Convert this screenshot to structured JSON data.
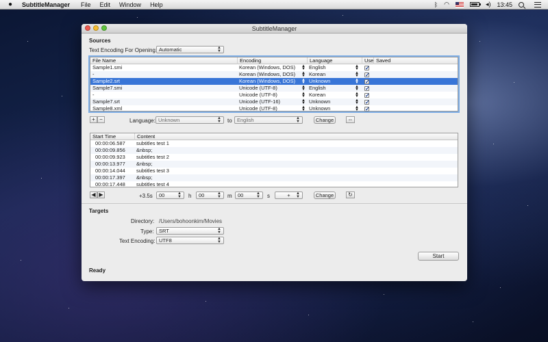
{
  "menubar": {
    "app_name": "SubtitleManager",
    "items": [
      "File",
      "Edit",
      "Window",
      "Help"
    ],
    "clock": "13:45"
  },
  "window": {
    "title": "SubtitleManager"
  },
  "sources": {
    "title": "Sources",
    "encoding_label": "Text Encoding For Opening:",
    "encoding_value": "Automatic",
    "columns": [
      "File Name",
      "Encoding",
      "Language",
      "Use",
      "Saved"
    ],
    "rows": [
      {
        "file": "Sample1.smi",
        "encoding": "Korean (Windows, DOS)",
        "language": "English",
        "use": true,
        "selected": false
      },
      {
        "file": "-",
        "encoding": "Korean (Windows, DOS)",
        "language": "Korean",
        "use": true,
        "selected": false
      },
      {
        "file": "Sample2.srt",
        "encoding": "Korean (Windows, DOS)",
        "language": "Unknown",
        "use": true,
        "selected": true
      },
      {
        "file": "Sample7.smi",
        "encoding": "Unicode (UTF-8)",
        "language": "English",
        "use": true,
        "selected": false
      },
      {
        "file": "-",
        "encoding": "Unicode (UTF-8)",
        "language": "Korean",
        "use": true,
        "selected": false
      },
      {
        "file": "Sample7.srt",
        "encoding": "Unicode (UTF-16)",
        "language": "Unknown",
        "use": true,
        "selected": false
      },
      {
        "file": "Sample8.xml",
        "encoding": "Unicode (UTF-8)",
        "language": "Unknown",
        "use": true,
        "selected": false
      }
    ],
    "add_label": "+",
    "remove_label": "−",
    "language_label": "Language:",
    "language_from": "Unknown",
    "to_label": "to",
    "language_to": "English",
    "change_label": "Change",
    "swap_label": "⇔"
  },
  "subtitles": {
    "columns": [
      "Start Time",
      "Content"
    ],
    "rows": [
      {
        "time": "00:00:06.587",
        "content": "subtitles test 1"
      },
      {
        "time": "00:00:09.856",
        "content": "&nbsp;"
      },
      {
        "time": "00:00:09.923",
        "content": "subtitles test 2"
      },
      {
        "time": "00:00:13.977",
        "content": "&nbsp;"
      },
      {
        "time": "00:00:14.044",
        "content": "subtitles test 3"
      },
      {
        "time": "00:00:17.397",
        "content": "&nbsp;"
      },
      {
        "time": "00:00:17.448",
        "content": "subtitles test 4"
      }
    ],
    "prev_label": "◀",
    "next_label": "▶",
    "offset": "+3.5s",
    "hours": "00",
    "h_label": "h",
    "minutes": "00",
    "m_label": "m",
    "seconds": "00",
    "s_label": "s",
    "sign": "+",
    "change_label": "Change",
    "refresh_label": "↻"
  },
  "targets": {
    "title": "Targets",
    "directory_label": "Directory:",
    "directory_value": "/Users/bohoonkim/Movies",
    "type_label": "Type:",
    "type_value": "SRT",
    "encoding_label": "Text Encoding:",
    "encoding_value": "UTF8",
    "start_label": "Start"
  },
  "status": {
    "text": "Ready"
  }
}
